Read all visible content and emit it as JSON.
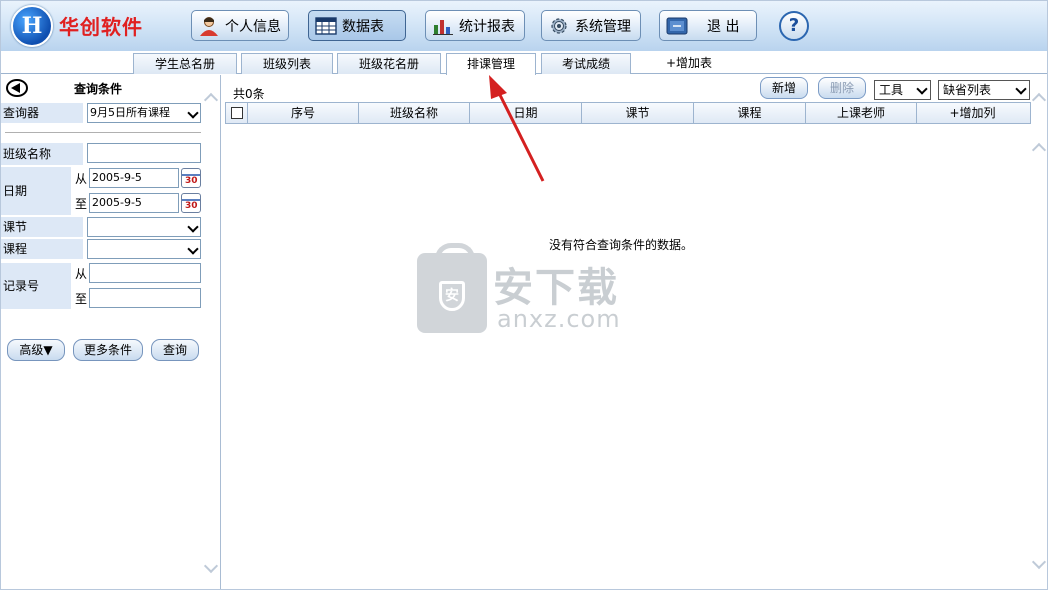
{
  "brand": {
    "name": "华创软件"
  },
  "nav": {
    "personal": "个人信息",
    "datatable": "数据表",
    "report": "统计报表",
    "system": "系统管理",
    "exit": "退 出",
    "help": "?"
  },
  "tabs": [
    {
      "label": "学生总名册"
    },
    {
      "label": "班级列表"
    },
    {
      "label": "班级花名册"
    },
    {
      "label": "排课管理",
      "active": true
    },
    {
      "label": "考试成绩"
    },
    {
      "label": "+增加表"
    }
  ],
  "left": {
    "title": "查询条件",
    "query_label": "查询器",
    "query_value": "9月5日所有课程",
    "class_name_label": "班级名称",
    "class_name_value": "",
    "date_label": "日期",
    "date_from_label": "从",
    "date_from_value": "2005-9-5",
    "date_to_label": "至",
    "date_to_value": "2005-9-5",
    "calendar_glyph": "30",
    "section_label": "课节",
    "section_value": "",
    "course_label": "课程",
    "course_value": "",
    "record_label": "记录号",
    "record_from_label": "从",
    "record_from_value": "",
    "record_to_label": "至",
    "record_to_value": "",
    "advanced_button": "高级▼",
    "more_button": "更多条件",
    "search_button": "查询"
  },
  "main": {
    "count": "共0条",
    "new_button": "新增",
    "delete_button": "删除",
    "tools_select": "工具",
    "list_select": "缺省列表",
    "columns": [
      "序号",
      "班级名称",
      "日期",
      "课节",
      "课程",
      "上课老师",
      "+增加列"
    ],
    "empty_message": "没有符合查询条件的数据。"
  },
  "watermark": {
    "text_cn": "安下载",
    "text_en": "anxz.com",
    "shield_glyph": "安"
  },
  "colors": {
    "brand_red": "#e02020",
    "header_blue": "#b9d3ee",
    "label_bg": "#dde8f6",
    "arrow_red": "#d42020"
  },
  "icons": {
    "personal": "person-icon",
    "datatable": "grid-icon",
    "report": "bar-chart-icon",
    "system": "gear-icon",
    "exit": "exit-sign-icon",
    "help": "question-icon"
  }
}
